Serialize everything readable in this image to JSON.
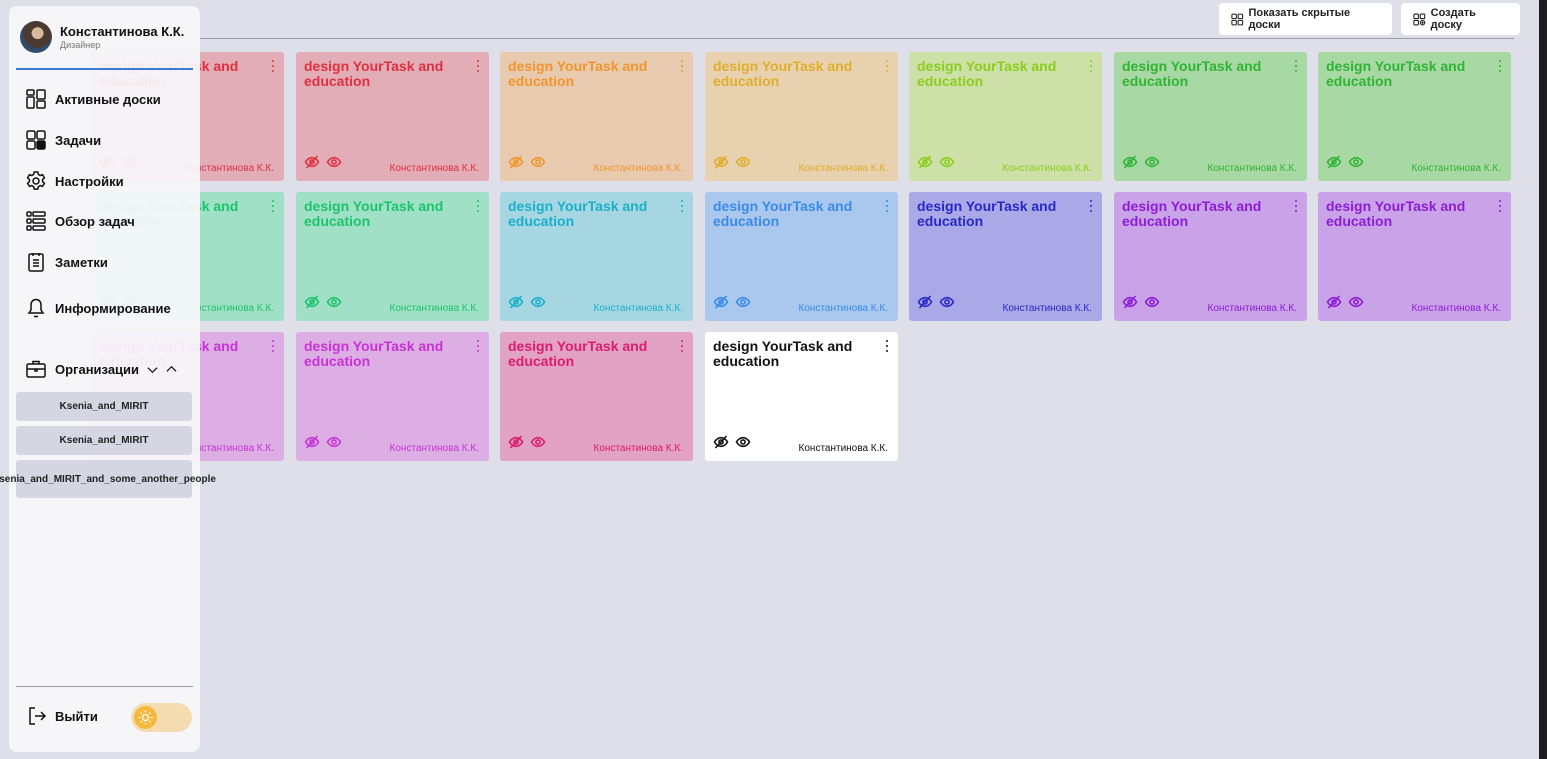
{
  "toolbar": {
    "show_hidden_label": "Показать скрытые доски",
    "create_label": "Создать доску"
  },
  "boards": [
    {
      "title": "design YourTask and education",
      "owner": "Константинова К.К.",
      "color": "#e03040",
      "bg": "#e2adb6"
    },
    {
      "title": "design YourTask and education",
      "owner": "Константинова К.К.",
      "color": "#e03040",
      "bg": "#e2adb6"
    },
    {
      "title": "design YourTask and education",
      "owner": "Константинова К.К.",
      "color": "#f0962c",
      "bg": "#e8caae"
    },
    {
      "title": "design YourTask and education",
      "owner": "Константинова К.К.",
      "color": "#e0ae2c",
      "bg": "#e7d1ae"
    },
    {
      "title": "design YourTask and education",
      "owner": "Константинова К.К.",
      "color": "#8ccd1e",
      "bg": "#cce0a7"
    },
    {
      "title": "design YourTask and education",
      "owner": "Константинова К.К.",
      "color": "#31b434",
      "bg": "#a8d8a4"
    },
    {
      "title": "design YourTask and education",
      "owner": "Константинова К.К.",
      "color": "#31b434",
      "bg": "#a8d8a4"
    },
    {
      "title": "design YourTask and education",
      "owner": "Константинова К.К.",
      "color": "#1cc46c",
      "bg": "#a0e0c6"
    },
    {
      "title": "design YourTask and education",
      "owner": "Константинова К.К.",
      "color": "#1cc46c",
      "bg": "#a0e0c6"
    },
    {
      "title": "design YourTask and education",
      "owner": "Константинова К.К.",
      "color": "#1ab0c8",
      "bg": "#a6d6e2"
    },
    {
      "title": "design YourTask and education",
      "owner": "Константинова К.К.",
      "color": "#3a8ae8",
      "bg": "#aac8ee"
    },
    {
      "title": "design YourTask and education",
      "owner": "Константинова К.К.",
      "color": "#2828c8",
      "bg": "#aaa8e6"
    },
    {
      "title": "design YourTask and education",
      "owner": "Константинова К.К.",
      "color": "#8c1cd8",
      "bg": "#caa2e8"
    },
    {
      "title": "design YourTask and education",
      "owner": "Константинова К.К.",
      "color": "#8c1cd8",
      "bg": "#caa2e8"
    },
    {
      "title": "design YourTask and education",
      "owner": "Константинова К.К.",
      "color": "#c832d6",
      "bg": "#dcaee4"
    },
    {
      "title": "design YourTask and education",
      "owner": "Константинова К.К.",
      "color": "#c832d6",
      "bg": "#dcaee4"
    },
    {
      "title": "design YourTask and education",
      "owner": "Константинова К.К.",
      "color": "#dc1c6c",
      "bg": "#e2a2c4"
    },
    {
      "title": "design YourTask and education",
      "owner": "Константинова К.К.",
      "color": "#111111",
      "bg": "#ffffff"
    }
  ],
  "sidebar": {
    "user_name": "Константинова К.К.",
    "user_role": "Дизайнер",
    "nav": [
      {
        "label": "Активные доски",
        "icon": "boards-icon"
      },
      {
        "label": "Задачи",
        "icon": "tasks-icon"
      },
      {
        "label": "Настройки",
        "icon": "gear-icon"
      },
      {
        "label": "Обзор задач",
        "icon": "list-icon"
      },
      {
        "label": "Заметки",
        "icon": "notes-icon"
      },
      {
        "label": "Информирование",
        "icon": "bell-icon"
      }
    ],
    "organizations_label": "Организации",
    "organizations": [
      "Ksenia_and_MIRIT",
      "Ksenia_and_MIRIT",
      "Ksenia_and_MIRIT_and_some_another_people"
    ],
    "logout_label": "Выйти"
  }
}
